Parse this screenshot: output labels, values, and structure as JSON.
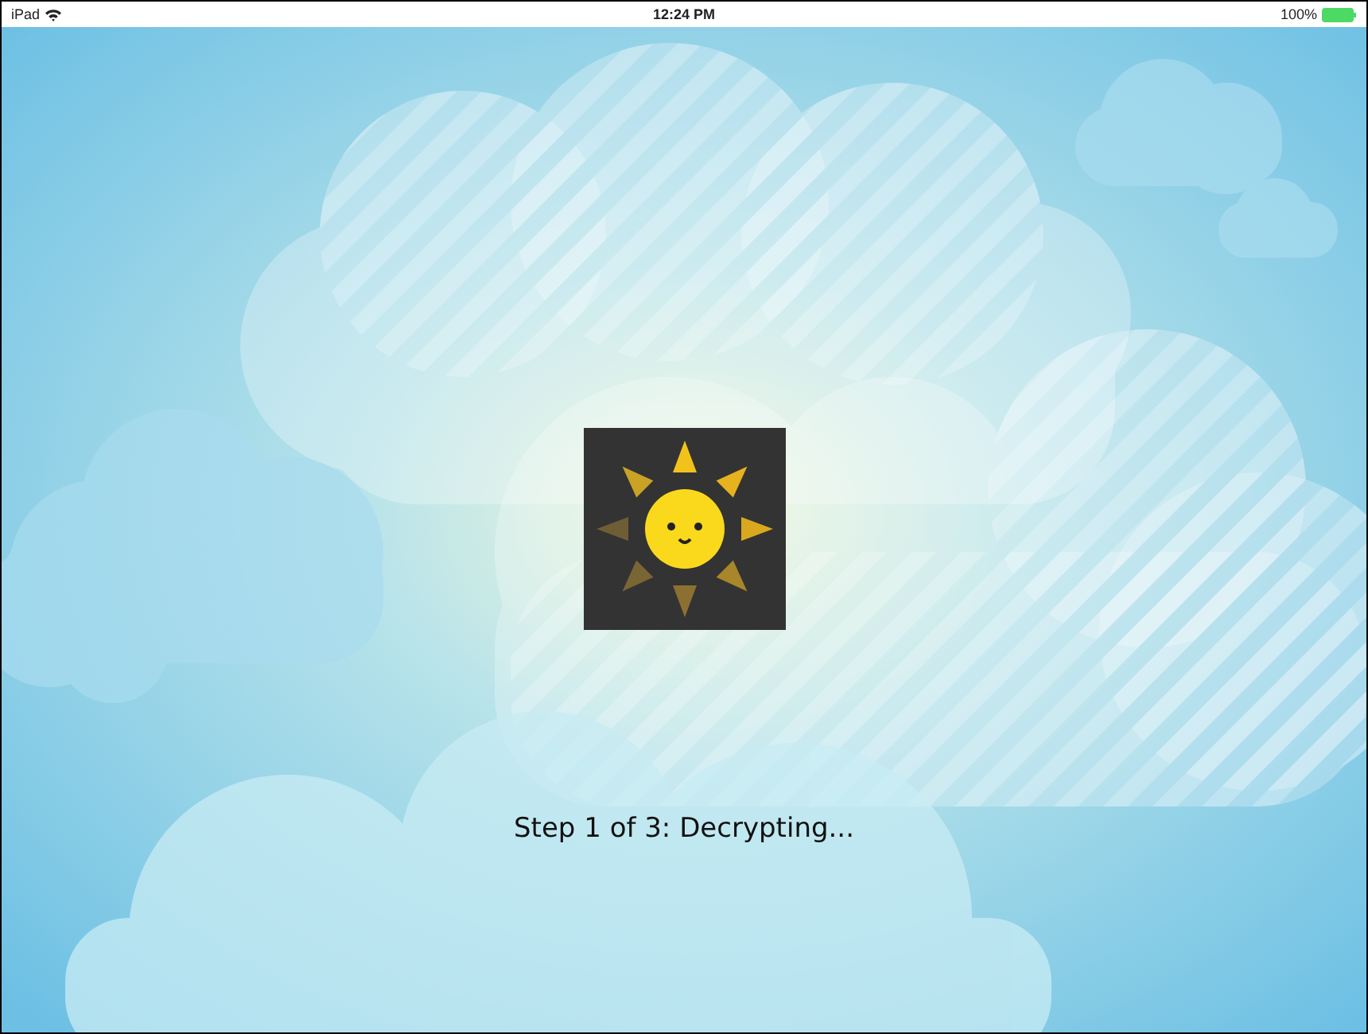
{
  "status_bar": {
    "device": "iPad",
    "time": "12:24 PM",
    "battery": "100%"
  },
  "message": "Step 1 of 3: Decrypting..."
}
